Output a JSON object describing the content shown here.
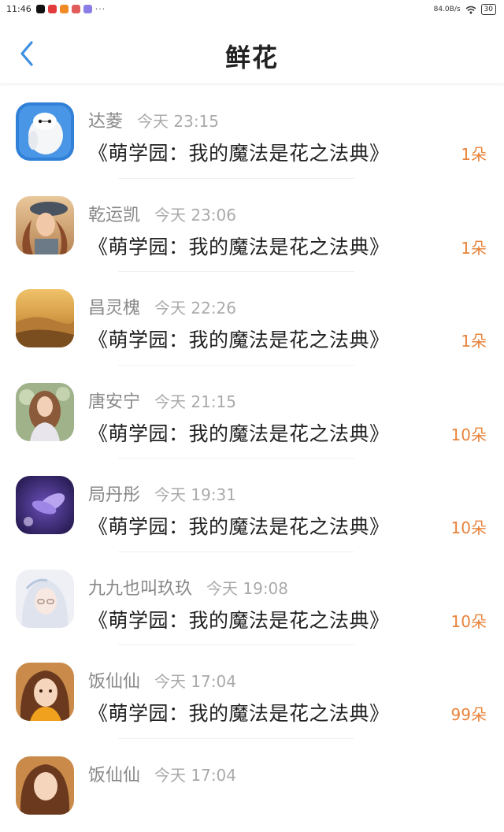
{
  "status_bar": {
    "time": "11:46",
    "more": "···",
    "net_speed": "84.0B/s",
    "battery": "30",
    "app_icon_colors": [
      "#111111",
      "#e23b3b",
      "#f08a24",
      "#e25c5c",
      "#8a7de8"
    ]
  },
  "nav": {
    "title": "鲜花",
    "back_icon": "chevron-left-icon",
    "accent_color": "#3d8fe0"
  },
  "rows": [
    {
      "name": "达菱",
      "time": "今天 23:15",
      "book": "《萌学园：我的魔法是花之法典》",
      "count": "1朵",
      "avatar": "white-robot"
    },
    {
      "name": "乾运凯",
      "time": "今天 23:06",
      "book": "《萌学园：我的魔法是花之法典》",
      "count": "1朵",
      "avatar": "woman-hat"
    },
    {
      "name": "昌灵槐",
      "time": "今天 22:26",
      "book": "《萌学园：我的魔法是花之法典》",
      "count": "1朵",
      "avatar": "desert-dunes"
    },
    {
      "name": "唐安宁",
      "time": "今天 21:15",
      "book": "《萌学园：我的魔法是花之法典》",
      "count": "10朵",
      "avatar": "curly-hair-girl"
    },
    {
      "name": "局丹彤",
      "time": "今天 19:31",
      "book": "《萌学园：我的魔法是花之法典》",
      "count": "10朵",
      "avatar": "purple-flower"
    },
    {
      "name": "九九也叫玖玖",
      "time": "今天 19:08",
      "book": "《萌学园：我的魔法是花之法典》",
      "count": "10朵",
      "avatar": "anime-girl-glasses"
    },
    {
      "name": "饭仙仙",
      "time": "今天 17:04",
      "book": "《萌学园：我的魔法是花之法典》",
      "count": "99朵",
      "avatar": "anime-girl-brown"
    },
    {
      "name": "饭仙仙",
      "time": "今天 17:04",
      "book": "",
      "count": "",
      "avatar": "anime-girl-brown"
    }
  ],
  "count_color": "#e8833a"
}
